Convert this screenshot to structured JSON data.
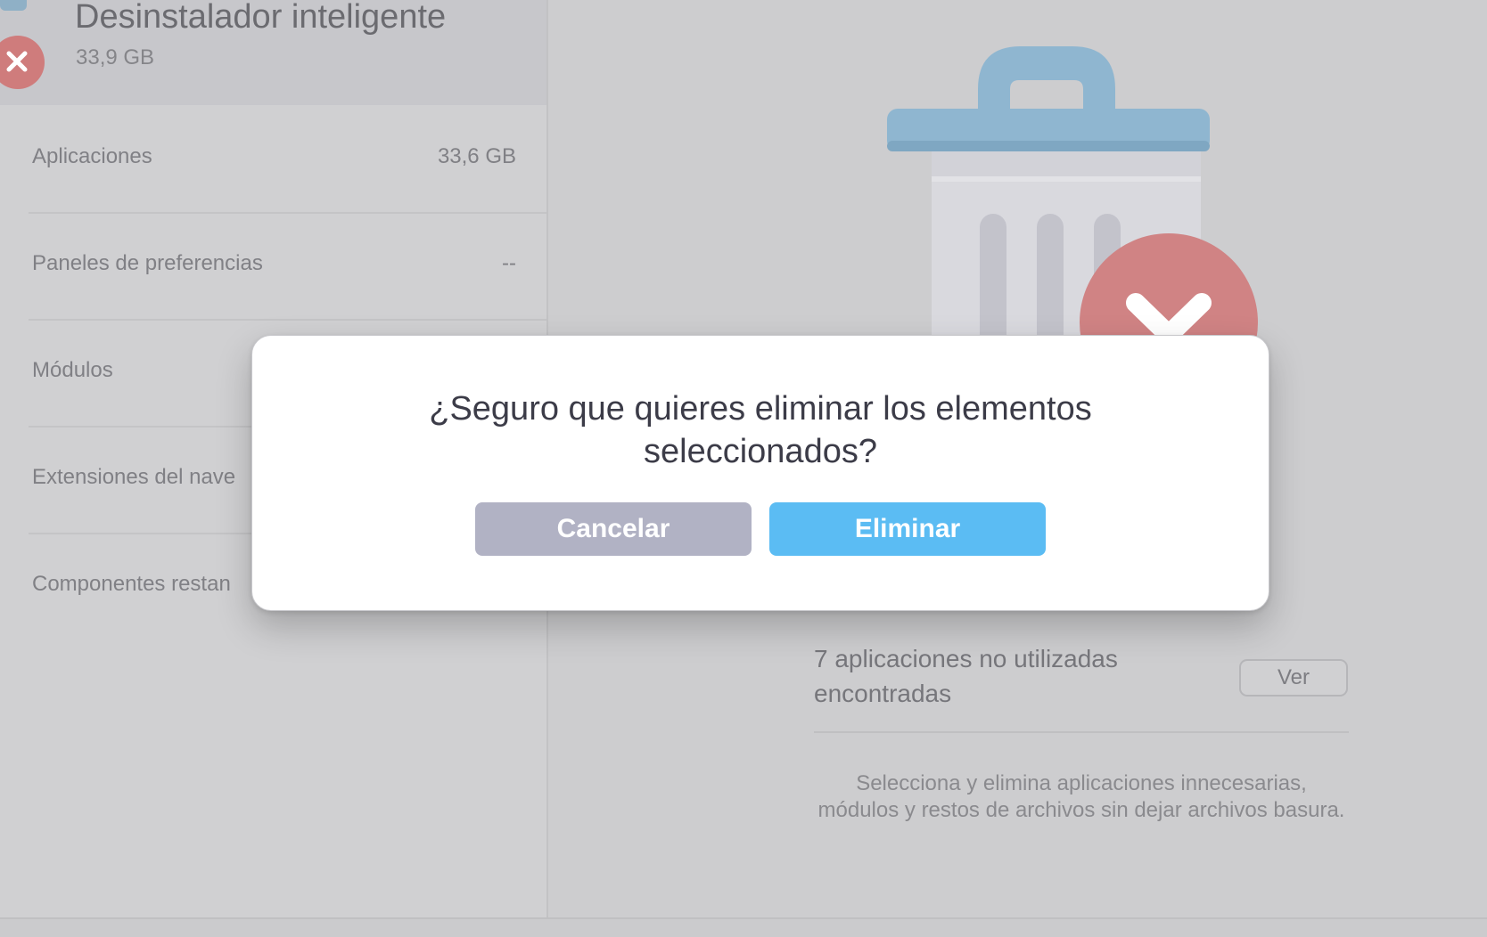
{
  "sidebar": {
    "header": {
      "title": "Desinstalador inteligente",
      "size": "33,9 GB"
    },
    "categories": [
      {
        "label": "Aplicaciones",
        "value": "33,6 GB"
      },
      {
        "label": "Paneles de preferencias",
        "value": "--"
      },
      {
        "label": "Módulos",
        "value": ""
      },
      {
        "label": "Extensiones del nave",
        "value": ""
      },
      {
        "label": "Componentes restan",
        "value": ""
      }
    ]
  },
  "main": {
    "summary": "7 aplicaciones no utilizadas encontradas",
    "view_button": "Ver",
    "description": "Selecciona y elimina aplicaciones innecesarias, módulos y restos de archivos sin dejar archivos basura."
  },
  "dialog": {
    "message": "¿Seguro que quieres eliminar los elementos seleccionados?",
    "cancel_label": "Cancelar",
    "confirm_label": "Eliminar"
  },
  "colors": {
    "accent": "#5bbcf3",
    "cancel": "#b1b2c4",
    "danger": "#cf7c7c",
    "trash_lid": "#8fb6d0"
  },
  "icons": {
    "header": "uninstaller-x-icon",
    "illustration": "trash-can-illustration",
    "badge": "remove-x-badge-icon"
  }
}
